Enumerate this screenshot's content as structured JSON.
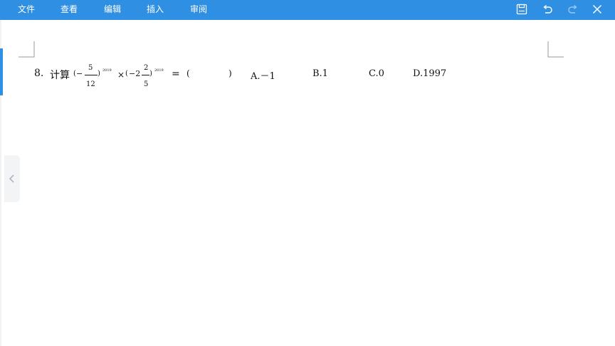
{
  "toolbar": {
    "menu": [
      {
        "label": "文件"
      },
      {
        "label": "查看"
      },
      {
        "label": "编辑"
      },
      {
        "label": "插入"
      },
      {
        "label": "审阅"
      }
    ],
    "icons": [
      "save-icon",
      "undo-icon",
      "redo-icon",
      "close-icon"
    ],
    "background_color": "#2f8fe3"
  },
  "sidebar": {
    "collapse_icon": "chevron-left-icon"
  },
  "question": {
    "number": "8.",
    "prompt": "计算",
    "term1": {
      "open": "(",
      "minus": "−",
      "numerator": "5",
      "denominator": "12",
      "close": ")",
      "exponent": "2019"
    },
    "times": "×",
    "term2": {
      "open": "(",
      "whole": "−2",
      "numerator": "2",
      "denominator": "5",
      "close": ")",
      "exponent": "2019"
    },
    "equals": "=",
    "blank_open": "(",
    "blank_close": ")",
    "options": [
      {
        "text": "A.－1"
      },
      {
        "text": "B.1"
      },
      {
        "text": "C.0"
      },
      {
        "text": "D.1997"
      }
    ]
  }
}
